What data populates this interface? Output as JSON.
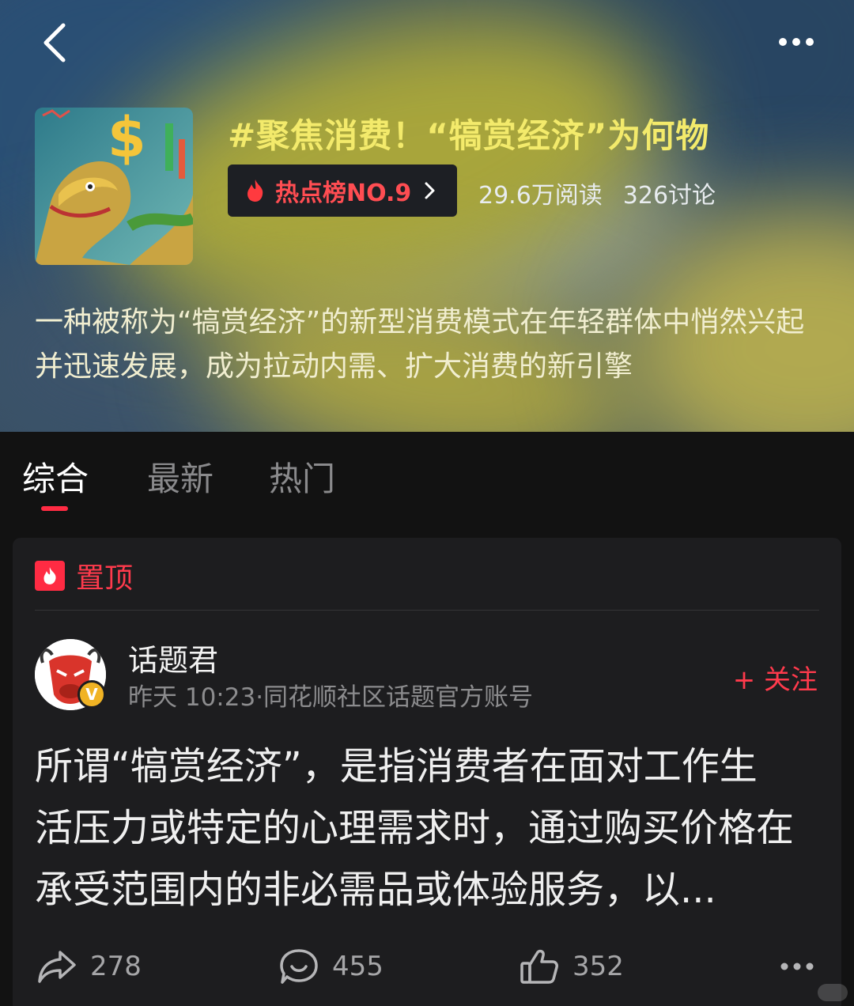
{
  "header": {
    "topic_title": "#聚焦消费！“犒赏经济”为何物",
    "hot_rank": "热点榜NO.9",
    "read_count": "29.6万阅读",
    "discuss_count": "326讨论",
    "description": "一种被称为“犒赏经济”的新型消费模式在年轻群体中悄然兴起并迅速发展，成为拉动内需、扩大消费的新引擎"
  },
  "tabs": [
    {
      "label": "综合",
      "active": true
    },
    {
      "label": "最新",
      "active": false
    },
    {
      "label": "热门",
      "active": false
    }
  ],
  "pinned": {
    "label": "置顶"
  },
  "post": {
    "author": "话题君",
    "meta": "昨天 10:23·同花顺社区话题官方账号",
    "follow_label": "+ 关注",
    "body": "所谓“犒赏经济”，是指消费者在面对工作生活压力或特定的心理需求时，通过购买价格在承受范围内的非必需品或体验服务，以...",
    "shares": "278",
    "comments": "455",
    "likes": "352"
  },
  "colors": {
    "accent": "#ff2b43",
    "title_yellow": "#f3ea6b",
    "background": "#121212"
  }
}
